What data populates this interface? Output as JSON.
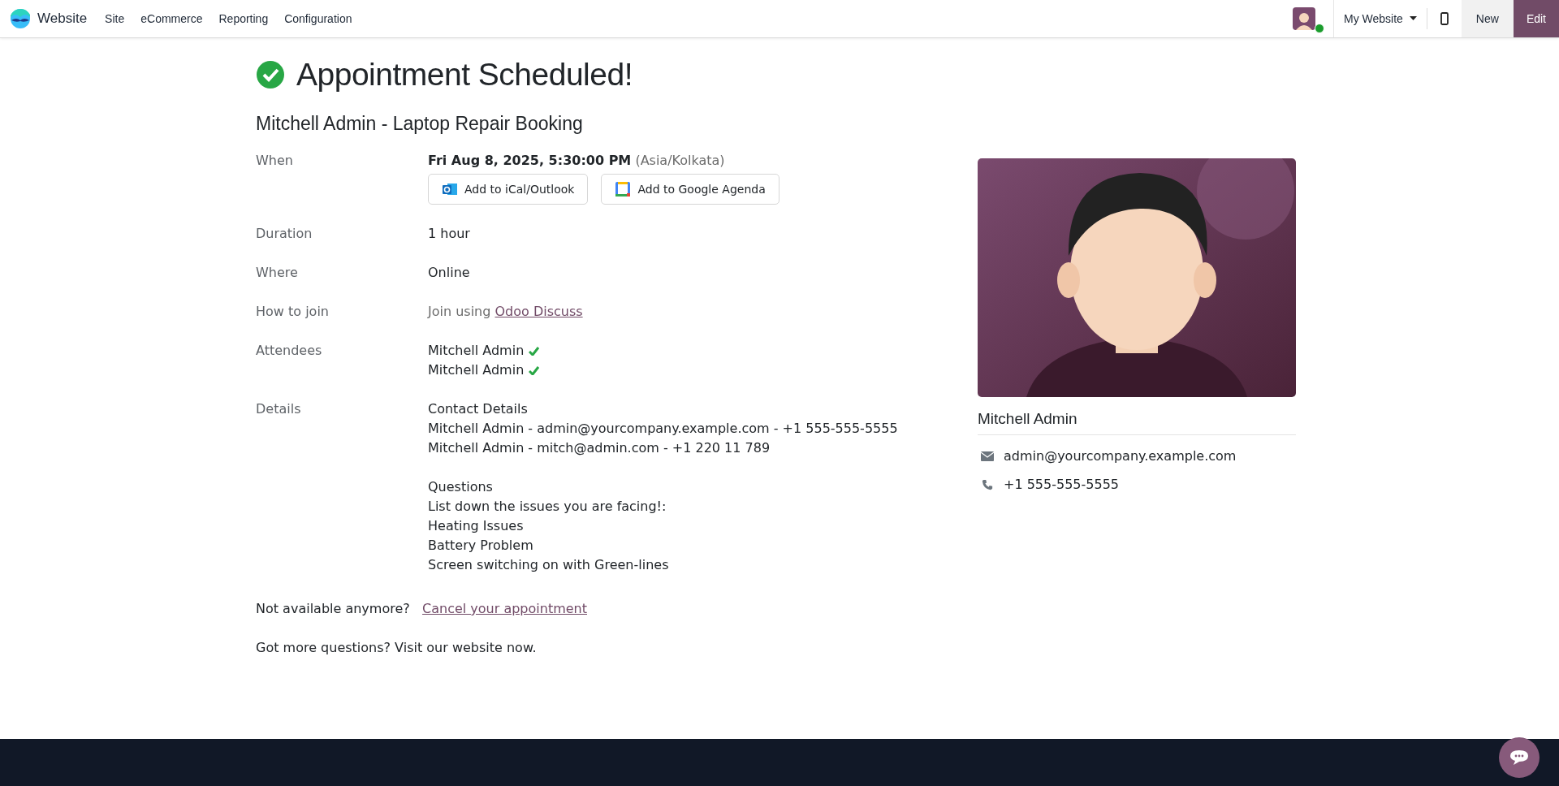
{
  "navbar": {
    "brand": "Website",
    "menu": [
      "Site",
      "eCommerce",
      "Reporting",
      "Configuration"
    ],
    "user_online": true,
    "website_switcher": "My Website",
    "buttons": [
      {
        "label": "New",
        "kind": "secondary"
      },
      {
        "label": "Edit",
        "kind": "primary"
      }
    ]
  },
  "heading": "Appointment Scheduled!",
  "subtitle": "Mitchell Admin - Laptop Repair Booking",
  "details": [
    {
      "kind": "when",
      "label": "When",
      "value": "Fri Aug 8, 2025, 5:30:00 PM",
      "timezone": "(Asia/Kolkata)",
      "buttons": [
        {
          "label": "Add to iCal/Outlook",
          "kind": "outlook"
        },
        {
          "label": "Add to Google Agenda",
          "kind": "google"
        }
      ]
    },
    {
      "kind": "text",
      "label": "Duration",
      "value": "1 hour"
    },
    {
      "kind": "text",
      "label": "Where",
      "value": "Online"
    },
    {
      "kind": "link",
      "label": "How to join",
      "text": "Join using",
      "link": "Odoo Discuss"
    },
    {
      "kind": "attendees",
      "label": "Attendees",
      "attendees": [
        {
          "name": "Mitchell Admin",
          "confirmed": true
        },
        {
          "name": "Mitchell Admin",
          "confirmed": true
        }
      ]
    },
    {
      "kind": "lines",
      "label": "Details",
      "groups": [
        [
          "Contact Details",
          "Mitchell Admin - admin@yourcompany.example.com - +1 555-555-5555",
          "Mitchell Admin - mitch@admin.com - +1 220 11 789"
        ],
        [
          "Questions",
          "List down the issues you are facing!:",
          "Heating Issues",
          "Battery Problem",
          "Screen switching on with Green-lines"
        ]
      ]
    }
  ],
  "cancel": {
    "text": "Not available anymore?",
    "link": "Cancel your appointment"
  },
  "note": "Got more questions? Visit our website now.",
  "staff": {
    "name": "Mitchell Admin",
    "email": "admin@yourcompany.example.com",
    "phone": "+1 555-555-5555"
  }
}
